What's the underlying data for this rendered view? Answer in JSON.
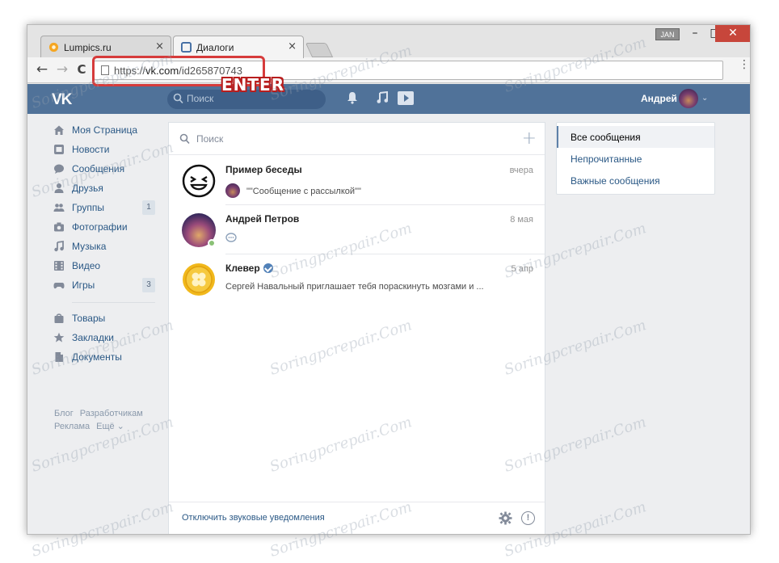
{
  "browser": {
    "tabs": [
      {
        "label": "Lumpics.ru",
        "close": "×"
      },
      {
        "label": "Диалоги",
        "close": "×"
      }
    ],
    "user_badge": "JAN",
    "window_buttons": {
      "minimize": "–",
      "maximize": "□",
      "close": "✕"
    },
    "nav": {
      "back": "←",
      "forward": "→",
      "reload": "C"
    },
    "url": {
      "scheme": "https://",
      "host": "vk.com",
      "path": "/id265870743"
    },
    "menu": "⋮"
  },
  "annotation": {
    "label": "ENTER",
    "color": "#d63b3b"
  },
  "vk": {
    "logo": "VK",
    "search_placeholder": "Поиск",
    "user_name": "Андрей",
    "user_chevron": "⌄",
    "left_nav": [
      {
        "label": "Моя Страница",
        "icon": "home-icon"
      },
      {
        "label": "Новости",
        "icon": "news-icon"
      },
      {
        "label": "Сообщения",
        "icon": "messages-icon"
      },
      {
        "label": "Друзья",
        "icon": "friends-icon"
      },
      {
        "label": "Группы",
        "icon": "groups-icon",
        "count": "1"
      },
      {
        "label": "Фотографии",
        "icon": "camera-icon"
      },
      {
        "label": "Музыка",
        "icon": "music-icon"
      },
      {
        "label": "Видео",
        "icon": "video-icon"
      },
      {
        "label": "Игры",
        "icon": "gamepad-icon",
        "count": "3"
      }
    ],
    "left_nav_secondary": [
      {
        "label": "Товары",
        "icon": "bag-icon"
      },
      {
        "label": "Закладки",
        "icon": "star-icon"
      },
      {
        "label": "Документы",
        "icon": "document-icon"
      }
    ],
    "footer_links": [
      "Блог",
      "Разработчикам",
      "Реклама",
      "Ещё ⌄"
    ],
    "dialogs": {
      "search_placeholder": "Поиск",
      "add": "+",
      "items": [
        {
          "name": "Пример беседы",
          "date": "вчера",
          "preview": "\"\"Сообщение с рассылкой\"\""
        },
        {
          "name": "Андрей Петров",
          "date": "8 мая",
          "preview": ""
        },
        {
          "name": "Клевер",
          "date": "5 апр",
          "preview": "Сергей Навальный приглашает тебя пораскинуть мозгами и ..."
        }
      ],
      "footer_text": "Отключить звуковые уведомления",
      "info": "!"
    },
    "filters": [
      {
        "label": "Все сообщения",
        "selected": true
      },
      {
        "label": "Непрочитанные",
        "selected": false
      },
      {
        "label": "Важные сообщения",
        "selected": false
      }
    ],
    "colors": {
      "header": "#507299",
      "link": "#2a5885",
      "bg": "#edeef0",
      "online": "#8ac176"
    }
  },
  "watermark": "Soringpcrepair.Com"
}
